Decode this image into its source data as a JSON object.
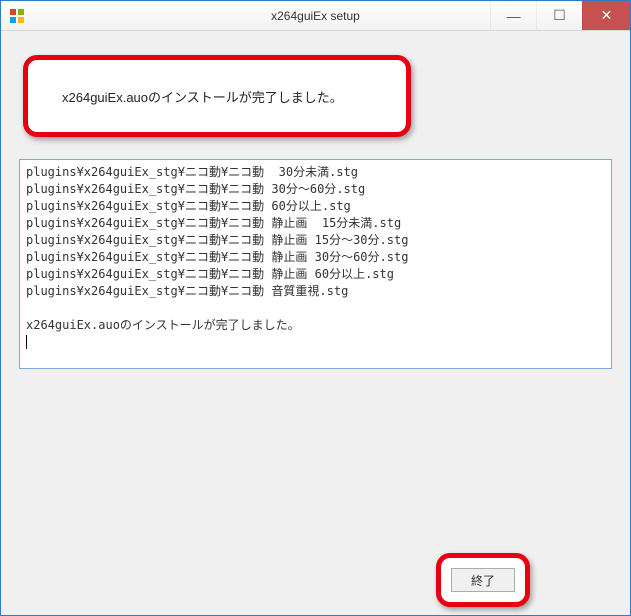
{
  "window": {
    "title": "x264guiEx setup"
  },
  "message": "x264guiEx.auoのインストールが完了しました。",
  "log_lines": [
    "plugins¥x264guiEx_stg¥ニコ動¥ニコ動  30分未満.stg",
    "plugins¥x264guiEx_stg¥ニコ動¥ニコ動 30分～60分.stg",
    "plugins¥x264guiEx_stg¥ニコ動¥ニコ動 60分以上.stg",
    "plugins¥x264guiEx_stg¥ニコ動¥ニコ動 静止画  15分未満.stg",
    "plugins¥x264guiEx_stg¥ニコ動¥ニコ動 静止画 15分～30分.stg",
    "plugins¥x264guiEx_stg¥ニコ動¥ニコ動 静止画 30分～60分.stg",
    "plugins¥x264guiEx_stg¥ニコ動¥ニコ動 静止画 60分以上.stg",
    "plugins¥x264guiEx_stg¥ニコ動¥ニコ動 音質重視.stg",
    "",
    "x264guiEx.auoのインストールが完了しました。"
  ],
  "buttons": {
    "close": "終了"
  },
  "win_controls": {
    "minimize": "—",
    "maximize": "☐",
    "close": "✕"
  }
}
